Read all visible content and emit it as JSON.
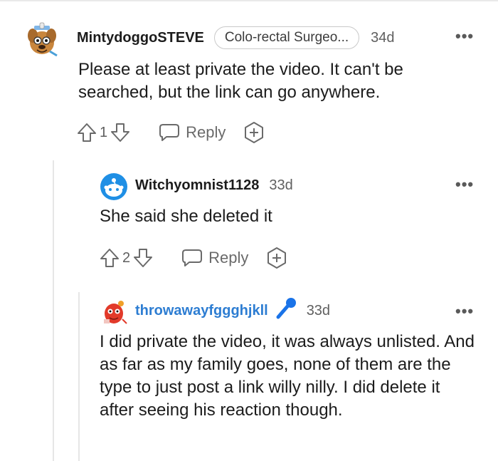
{
  "comments": [
    {
      "username": "MintydoggoSTEVE",
      "flair": "Colo-rectal Surgeo...",
      "age": "34d",
      "text": "Please at least private the video. It can't be searched, but the link can go anywhere.",
      "votes": "1",
      "reply_label": "Reply"
    },
    {
      "username": "Witchyomnist1128",
      "age": "33d",
      "text": "She said she deleted it",
      "votes": "2",
      "reply_label": "Reply"
    },
    {
      "username": "throwawayfggghjkll",
      "age": "33d",
      "text": "I did private the video, it was always unlisted. And as far as my family goes, none of them are the type to just post a link willy nilly. I did delete it after seeing his reaction though."
    }
  ],
  "more_options": "•••",
  "colors": {
    "op_blue": "#2d7dd2",
    "mic_blue": "#1a73e8"
  }
}
